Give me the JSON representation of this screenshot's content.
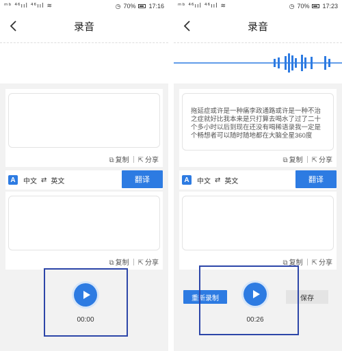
{
  "left": {
    "status": {
      "signal": "ᵐᵇ ⁴⁶ııl ⁴⁶ııl ≋",
      "battery_percent": "70%",
      "time": "17:16"
    },
    "title": "录音",
    "result_text": "",
    "copy_label": "复制",
    "share_label": "分享",
    "lang_from": "中文",
    "lang_swap": "⇄",
    "lang_to": "英文",
    "translate_label": "翻译",
    "translation_text": "",
    "copy_label_2": "复制",
    "share_label_2": "分享",
    "timer": "00:00"
  },
  "right": {
    "status": {
      "signal": "ᵐᵇ ⁴⁶ııl ⁴⁶ııl ≋",
      "battery_percent": "70%",
      "time": "17:23"
    },
    "title": "录音",
    "result_text": "拖延症或许是一种痛李政通路或许是一种不治之症就好比我本来是只打算去喝水了过了二十个多小时以后到现在还没有喝稀语录我一定是个畅想者可以随时随地都在大脑全星360度",
    "copy_label": "复制",
    "share_label": "分享",
    "lang_from": "中文",
    "lang_swap": "⇄",
    "lang_to": "英文",
    "translate_label": "翻译",
    "translation_text": "",
    "copy_label_2": "复制",
    "share_label_2": "分享",
    "rerecord_label": "重新录制",
    "save_label": "保存",
    "timer": "00:26"
  },
  "colors": {
    "accent": "#2d7be2",
    "highlight_box": "#2c45a8"
  }
}
